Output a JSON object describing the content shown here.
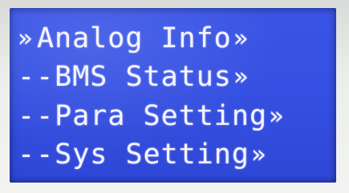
{
  "menu": {
    "items": [
      {
        "prefix": "»",
        "label": "Analog Info",
        "arrow": "»",
        "selected": true
      },
      {
        "prefix": "--",
        "label": "BMS Status",
        "arrow": "»",
        "selected": false
      },
      {
        "prefix": "--",
        "label": "Para Setting",
        "arrow": "»",
        "selected": false
      },
      {
        "prefix": "--",
        "label": "Sys Setting",
        "arrow": "»",
        "selected": false
      }
    ]
  },
  "colors": {
    "lcd_background": "#3550e2",
    "lcd_text": "#f4f4ff"
  }
}
